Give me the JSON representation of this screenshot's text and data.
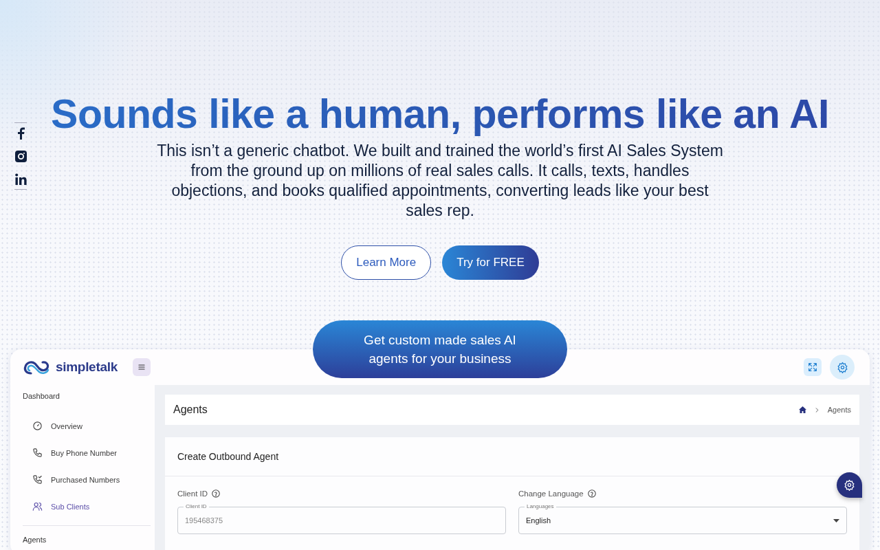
{
  "hero": {
    "title": "Sounds like a human, performs like an AI",
    "text": "This isn’t a generic chatbot. We built and trained the world’s first AI Sales System from the ground up on millions of real sales calls. It calls, texts, handles objections, and books qualified appointments, converting leads like your best sales rep.",
    "buttons": [
      {
        "label": "Learn More",
        "kind": "outline"
      },
      {
        "label": "Try for FREE",
        "kind": "filled"
      }
    ]
  },
  "social": [
    {
      "kind": "facebook"
    },
    {
      "kind": "instagram"
    },
    {
      "kind": "linkedin"
    }
  ],
  "cta": "Get custom made sales AI agents for your business",
  "app": {
    "logo": "simpletalk",
    "sidebar": {
      "sections": [
        {
          "title": "Dashboard",
          "items": [
            {
              "label": "Overview",
              "kind": "gauge",
              "selected": false
            },
            {
              "label": "Buy Phone Number",
              "kind": "phone",
              "selected": false
            },
            {
              "label": "Purchased Numbers",
              "kind": "phone-check",
              "selected": false
            },
            {
              "label": "Sub Clients",
              "kind": "users",
              "selected": true
            }
          ]
        },
        {
          "title": "Agents"
        }
      ]
    },
    "page_title": "Agents",
    "breadcrumb": "Agents",
    "form_title": "Create Outbound Agent",
    "fields": [
      {
        "label": "Client ID",
        "legend": "Client ID",
        "value": "195468375",
        "kind": "text"
      },
      {
        "label": "Change Language",
        "legend": "Languages",
        "value": "English",
        "kind": "select"
      }
    ]
  }
}
